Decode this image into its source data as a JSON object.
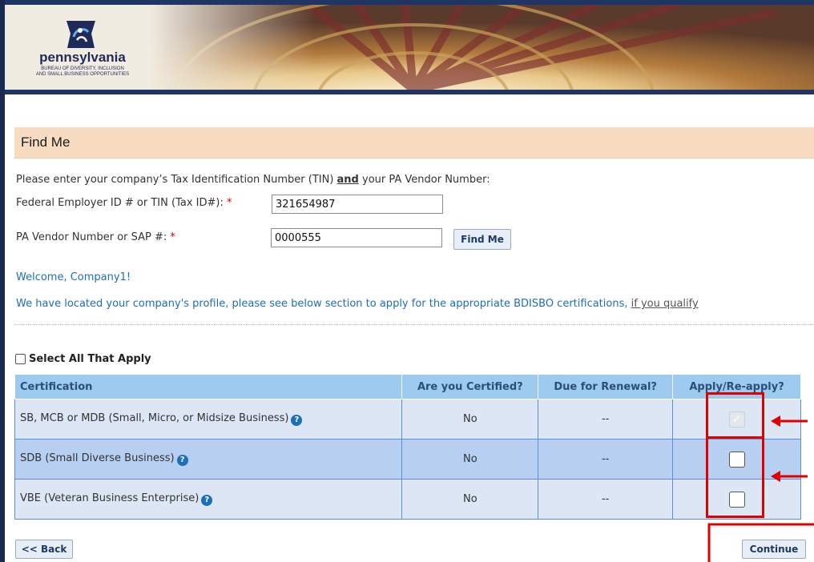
{
  "banner": {
    "logo_name": "pennsylvania",
    "logo_sub_line1": "BUREAU OF DIVERSITY, INCLUSION",
    "logo_sub_line2": "AND SMALL BUSINESS OPPORTUNITIES"
  },
  "find": {
    "title": "Find Me",
    "intro_prefix": "Please enter your company’s Tax Identification Number (TIN) ",
    "intro_and": "and",
    "intro_suffix": " your PA Vendor Number:",
    "tin_label": "Federal Employer ID # or TIN (Tax ID#):",
    "tin_value": "321654987",
    "vendor_label": "PA Vendor Number or SAP #:",
    "vendor_value": "0000555",
    "required_mark": "*",
    "find_button": "Find Me",
    "welcome": "Welcome, Company1!",
    "located_text": "We have located your company's profile, please see below section to apply for the appropriate BDISBO certifications, ",
    "qualify_link": "if you qualify"
  },
  "select_all": {
    "label": "Select All That Apply",
    "checked": false
  },
  "table": {
    "headers": [
      "Certification",
      "Are you Certified?",
      "Due for Renewal?",
      "Apply/Re-apply?"
    ],
    "rows": [
      {
        "certification": "SB, MCB or MDB (Small, Micro, or Midsize Business)",
        "certified": "No",
        "renewal": "--",
        "apply_checked": true,
        "apply_disabled": true
      },
      {
        "certification": "SDB (Small Diverse Business)",
        "certified": "No",
        "renewal": "--",
        "apply_checked": false,
        "apply_disabled": false
      },
      {
        "certification": "VBE (Veteran Business Enterprise)",
        "certified": "No",
        "renewal": "--",
        "apply_checked": false,
        "apply_disabled": false
      }
    ]
  },
  "nav": {
    "back_button": "<< Back",
    "continue_button": "Continue"
  },
  "colors": {
    "header_bg": "#f8dcc2",
    "table_header_bg": "#9dcbef",
    "link_blue": "#1d6fb8",
    "annotation_red": "#e00000"
  }
}
